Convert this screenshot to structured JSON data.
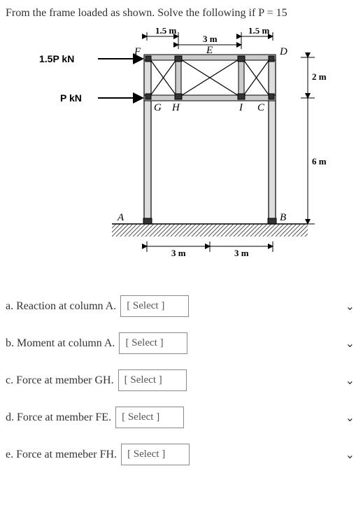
{
  "problem": "From the frame loaded as shown. Solve the following if P = 15",
  "diagram": {
    "dims": {
      "top_left": "1.5 m",
      "top_mid": "3 m",
      "top_right": "1.5 m",
      "label_E": "E",
      "right_upper": "2 m",
      "right_lower": "6 m",
      "bot_left": "3 m",
      "bot_right": "3 m"
    },
    "loads": {
      "upper": "1.5P kN",
      "lower": "P kN"
    },
    "pts": {
      "F": "F",
      "D": "D",
      "G": "G",
      "H": "H",
      "I": "I",
      "C": "C",
      "A": "A",
      "B": "B"
    }
  },
  "questions": {
    "a": {
      "label": "a. Reaction at column A.",
      "placeholder": "[ Select ]"
    },
    "b": {
      "label": "b. Moment at column A.",
      "placeholder": "[ Select ]"
    },
    "c": {
      "label": "c. Force at member GH.",
      "placeholder": "[ Select ]"
    },
    "d": {
      "label": "d. Force at member FE.",
      "placeholder": "[ Select ]"
    },
    "e": {
      "label": "e. Force at memeber FH.",
      "placeholder": "[ Select ]"
    }
  }
}
